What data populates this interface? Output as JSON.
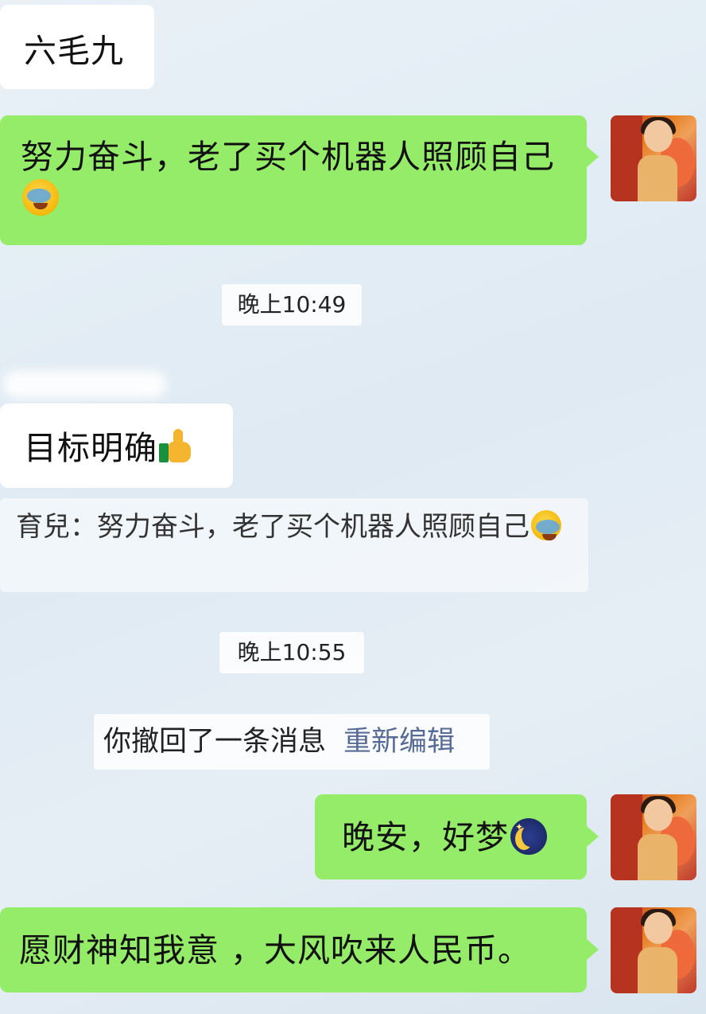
{
  "messages": {
    "m1": {
      "text": "六毛九"
    },
    "m2": {
      "text": "努力奋斗，老了买个机器人照顾自己"
    },
    "time1": {
      "text": "晚上10:49"
    },
    "m3": {
      "text": "目标明确"
    },
    "quote": {
      "text": "育兒：努力奋斗，老了买个机器人照顾自己"
    },
    "time2": {
      "text": "晚上10:55"
    },
    "system": {
      "text": "你撤回了一条消息",
      "action": "重新编辑"
    },
    "m4": {
      "text": "晚安，好梦"
    },
    "m5": {
      "text": "愿财神知我意 ，大风吹来人民币。"
    }
  },
  "icons": {
    "emoji1": "face-palm-tears-emoji",
    "emoji2": "thumbs-up-emoji",
    "emoji3": "crescent-moon-night-emoji"
  },
  "colors": {
    "sent_bubble": "#95ec69",
    "received_bubble": "#ffffff",
    "link": "#576b95"
  }
}
